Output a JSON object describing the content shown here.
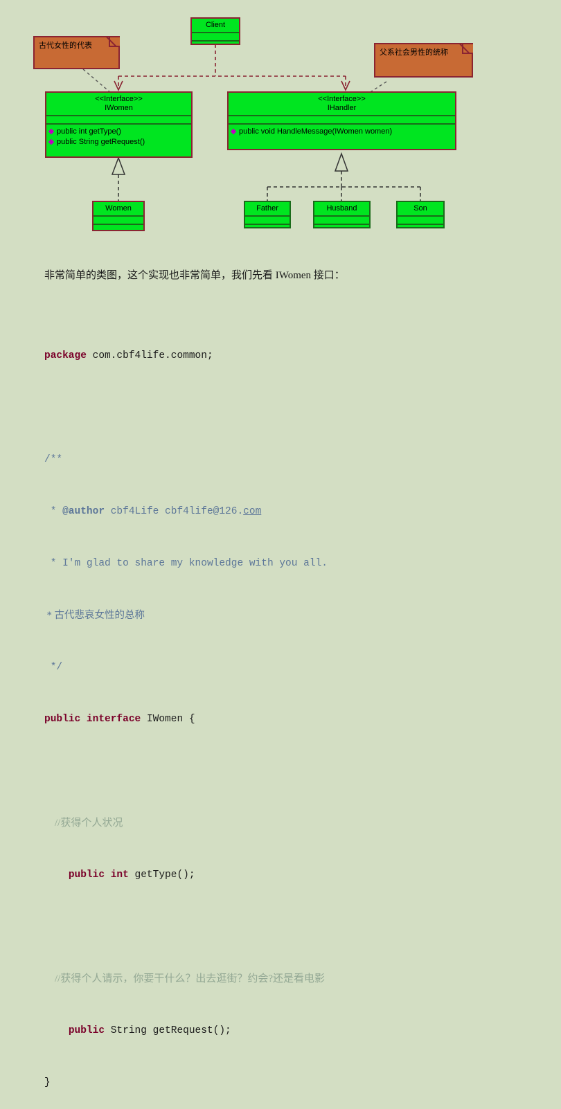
{
  "palette": {
    "page_bg": "#d3dec3",
    "class_fill": "#00e520",
    "class_border": "#1a6b1a",
    "selected_border": "#8a2432",
    "note_fill": "#c86a34",
    "note_border": "#8a2432",
    "dependency_line": "#8a2432",
    "realization_line": "#333333",
    "member_bullet": "#c000c0",
    "keyword": "#7a0029",
    "block_comment": "#5d7799",
    "line_comment": "#93a894"
  },
  "diagram": {
    "title": "UML class diagram",
    "classes": [
      {
        "id": "client",
        "name": "Client",
        "stereotype": "",
        "members": [],
        "selected": true
      },
      {
        "id": "iwomen",
        "name": "IWomen",
        "stereotype": "<<Interface>>",
        "members": [
          "public int getType()",
          "public String getRequest()"
        ],
        "selected": true
      },
      {
        "id": "ihandler",
        "name": "IHandler",
        "stereotype": "<<Interface>>",
        "members": [
          "public void HandleMessage(IWomen women)"
        ],
        "selected": true
      },
      {
        "id": "women",
        "name": "Women",
        "stereotype": "",
        "members": [],
        "selected": true
      },
      {
        "id": "father",
        "name": "Father",
        "stereotype": "",
        "members": [],
        "selected": false
      },
      {
        "id": "husband",
        "name": "Husband",
        "stereotype": "",
        "members": [],
        "selected": false
      },
      {
        "id": "son",
        "name": "Son",
        "stereotype": "",
        "members": [],
        "selected": false
      }
    ],
    "notes": [
      {
        "id": "note-women",
        "text": "古代女性的代表",
        "attached_to": "iwomen"
      },
      {
        "id": "note-handler",
        "text": "父系社会男性的统称",
        "attached_to": "ihandler"
      }
    ],
    "relations": [
      {
        "type": "dependency",
        "from": "client",
        "to": "iwomen"
      },
      {
        "type": "dependency",
        "from": "client",
        "to": "ihandler"
      },
      {
        "type": "realization",
        "from": "women",
        "to": "iwomen"
      },
      {
        "type": "realization",
        "from": "father",
        "to": "ihandler"
      },
      {
        "type": "realization",
        "from": "husband",
        "to": "ihandler"
      },
      {
        "type": "realization",
        "from": "son",
        "to": "ihandler"
      }
    ]
  },
  "prose": {
    "paragraph": "非常简单的类图，这个实现也非常简单，我们先看 IWomen 接口："
  },
  "code": {
    "language": "java",
    "line_01_kw": "package",
    "line_01_rest": " com.cbf4life.common;",
    "line_02": "",
    "line_03": "/**",
    "line_04_star": " * ",
    "line_04_tag": "@author",
    "line_04_rest": " cbf4Life cbf4life@126.",
    "line_04_link": "com",
    "line_05": " * I'm glad to share my knowledge with you all.",
    "line_06": " * 古代悲哀女性的总称",
    "line_07": " */",
    "line_08_kw": "public interface",
    "line_08_rest": " IWomen {",
    "line_09": "",
    "line_10": "    //获得个人状况",
    "line_11_indent": "    ",
    "line_11_kw": "public int",
    "line_11_rest": " getType();",
    "line_12": "",
    "line_13": "    //获得个人请示，你要干什么？出去逛街？约会?还是看电影",
    "line_14_indent": "    ",
    "line_14_kw": "public",
    "line_14_rest": " String getRequest();",
    "line_15": "}"
  }
}
